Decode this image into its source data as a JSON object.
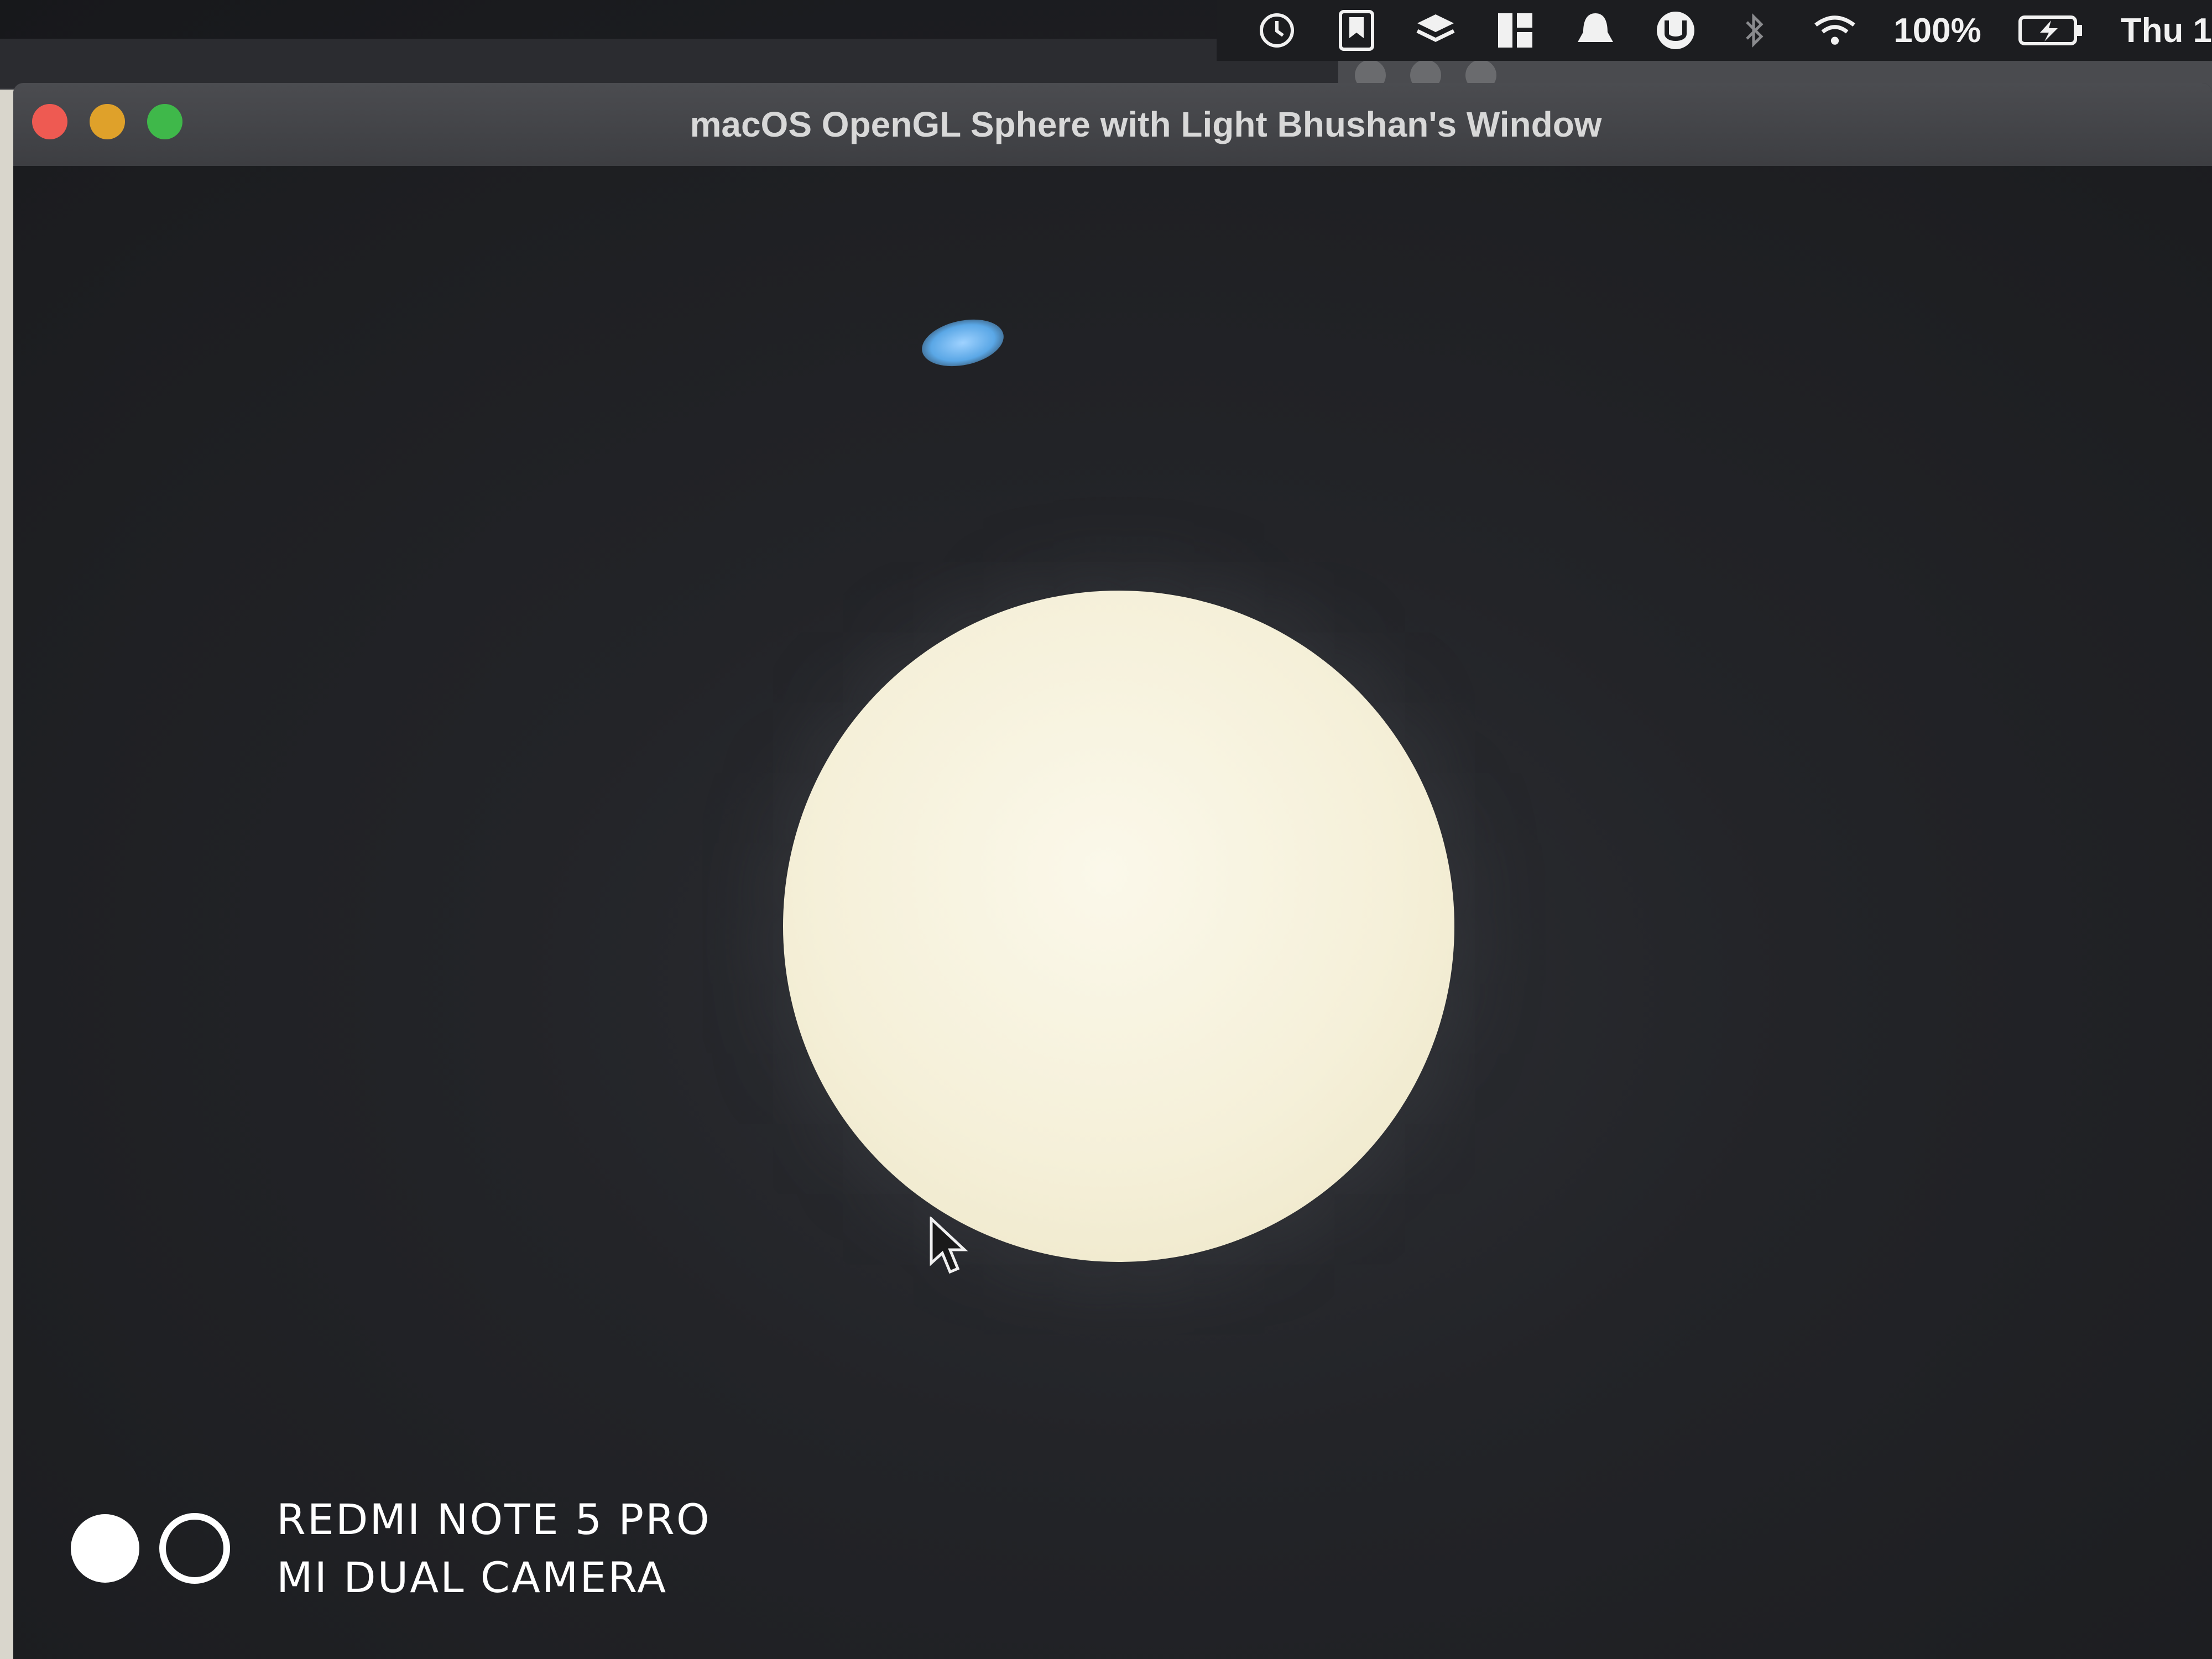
{
  "menubar": {
    "battery_percent": "100%",
    "clock": "Thu 1"
  },
  "main_window": {
    "title": "macOS OpenGL Sphere with Light Bhushan's Window"
  },
  "camera_watermark": {
    "line1": "REDMI NOTE 5 PRO",
    "line2": "MI DUAL CAMERA"
  },
  "colors": {
    "close": "#ee5a52",
    "minimize": "#dfa12a",
    "zoom": "#3fb84a",
    "sphere": "#f5f0d9",
    "glare": "#5aa7e6"
  }
}
